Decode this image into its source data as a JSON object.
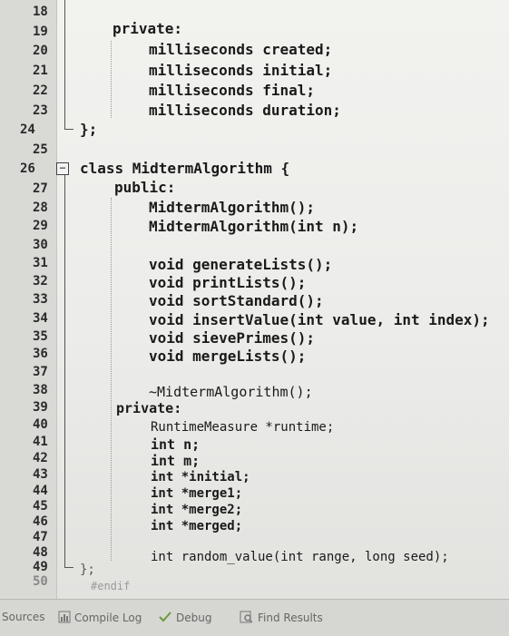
{
  "editor": {
    "line_numbers": [
      "18",
      "19",
      "20",
      "21",
      "22",
      "23",
      "24",
      "25",
      "26",
      "27",
      "28",
      "29",
      "30",
      "31",
      "32",
      "33",
      "34",
      "35",
      "36",
      "37",
      "38",
      "39",
      "40",
      "41",
      "42",
      "43",
      "44",
      "45",
      "46",
      "47",
      "48",
      "49",
      "50"
    ],
    "code_lines": [
      "private:",
      "milliseconds created;",
      "milliseconds initial;",
      "milliseconds final;",
      "milliseconds duration;",
      "};",
      "class MidtermAlgorithm {",
      "public:",
      "MidtermAlgorithm();",
      "MidtermAlgorithm(int n);",
      "void generateLists();",
      "void printLists();",
      "void sortStandard();",
      "void insertValue(int value, int index);",
      "void sievePrimes();",
      "void mergeLists();",
      "~MidtermAlgorithm();",
      "private:",
      "RuntimeMeasure *runtime;",
      "int n;",
      "int m;",
      "int *initial;",
      "int *merge1;",
      "int *merge2;",
      "int *merged;",
      "int random_value(int range, long seed);",
      "};",
      "#endif"
    ]
  },
  "statusbar": {
    "sources_label": "Sources",
    "compile_log_label": "Compile Log",
    "debug_label": "Debug",
    "find_results_label": "Find Results"
  }
}
